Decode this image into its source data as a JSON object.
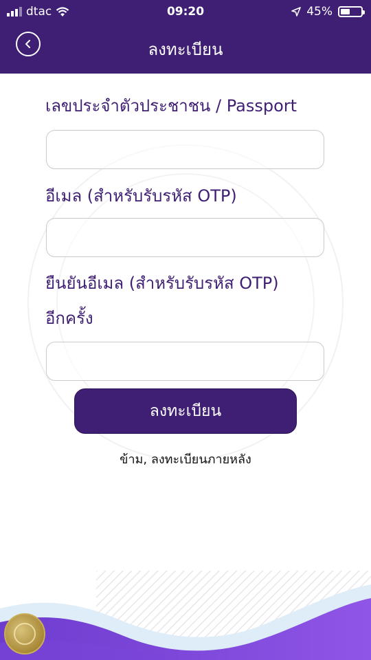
{
  "status_bar": {
    "carrier": "dtac",
    "time": "09:20",
    "battery_percent": "45%",
    "battery_level": 0.45,
    "icons": [
      "signal-icon",
      "wifi-icon",
      "location-arrow-icon",
      "battery-icon"
    ]
  },
  "header": {
    "title": "ลงทะเบียน",
    "back_icon": "chevron-left-icon"
  },
  "form": {
    "id_label": "เลขประจำตัวประชาชน / Passport",
    "id_value": "",
    "email_label": "อีเมล (สำหรับรับรหัส OTP)",
    "email_value": "",
    "confirm_label_line1": "ยืนยันอีเมล (สำหรับรับรหัส OTP)",
    "confirm_label_line2": "อีกครั้ง",
    "confirm_value": ""
  },
  "actions": {
    "register_label": "ลงทะเบียน",
    "skip_label": "ข้าม, ลงทะเบียนภายหลัง"
  },
  "colors": {
    "primary": "#3f1f73",
    "wave_purple": "#8b4fe0",
    "wave_light": "#dfeefa",
    "seal_gold": "#b8983f"
  }
}
